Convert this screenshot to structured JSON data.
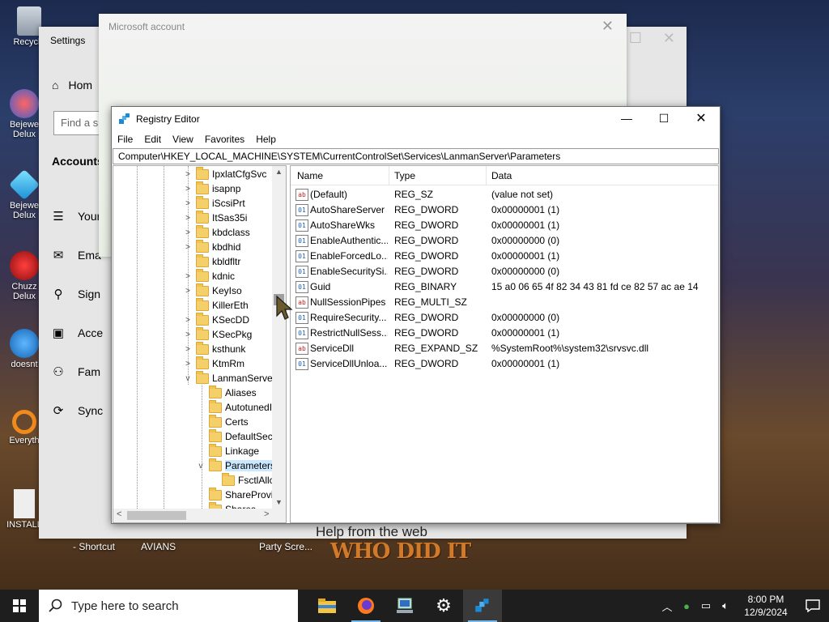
{
  "desktop": {
    "icons": [
      {
        "label": "Recycle"
      },
      {
        "label": "Bejewe Delux"
      },
      {
        "label": "Bejewe Delux"
      },
      {
        "label": "Chuzz Delux"
      },
      {
        "label": "doesnt"
      },
      {
        "label": "Everyth"
      },
      {
        "label": "INSTALL"
      }
    ],
    "bottom_labels": [
      "- Shortcut",
      "AVIANS",
      "Party Scre..."
    ],
    "wallpaper_text": "WHO DID IT"
  },
  "settings": {
    "title": "Settings",
    "home": "Hom",
    "search_placeholder": "Find a s",
    "section": "Accounts",
    "nav": [
      {
        "icon": "person-card-icon",
        "label": "Your"
      },
      {
        "label": "Ema",
        "icon": "mail-icon"
      },
      {
        "label": "Sign",
        "icon": "key-icon"
      },
      {
        "label": "Acce",
        "icon": "briefcase-icon"
      },
      {
        "label": "Fam",
        "icon": "family-icon"
      },
      {
        "label": "Sync",
        "icon": "sync-icon"
      }
    ],
    "help": "Help from the web"
  },
  "ms_account": {
    "title": "Microsoft account"
  },
  "regedit": {
    "title": "Registry Editor",
    "menu": [
      "File",
      "Edit",
      "View",
      "Favorites",
      "Help"
    ],
    "address": "Computer\\HKEY_LOCAL_MACHINE\\SYSTEM\\CurrentControlSet\\Services\\LanmanServer\\Parameters",
    "tree": [
      {
        "label": "IpxlatCfgSvc"
      },
      {
        "label": "isapnp"
      },
      {
        "label": "iScsiPrt"
      },
      {
        "label": "ItSas35i"
      },
      {
        "label": "kbdclass"
      },
      {
        "label": "kbdhid"
      },
      {
        "label": "kbldfltr"
      },
      {
        "label": "kdnic"
      },
      {
        "label": "KeyIso"
      },
      {
        "label": "KillerEth"
      },
      {
        "label": "KSecDD"
      },
      {
        "label": "KSecPkg"
      },
      {
        "label": "ksthunk"
      },
      {
        "label": "KtmRm"
      },
      {
        "label": "LanmanServer"
      },
      {
        "label": "Aliases"
      },
      {
        "label": "AutotunedI"
      },
      {
        "label": "Certs"
      },
      {
        "label": "DefaultSecu"
      },
      {
        "label": "Linkage"
      },
      {
        "label": "Parameters"
      },
      {
        "label": "FsctlAllc"
      },
      {
        "label": "ShareProvid"
      },
      {
        "label": "Shares"
      }
    ],
    "columns": {
      "name": "Name",
      "type": "Type",
      "data": "Data"
    },
    "values": [
      {
        "name": "(Default)",
        "type": "REG_SZ",
        "data": "(value not set)",
        "icon": "string-value-icon"
      },
      {
        "name": "AutoShareServer",
        "type": "REG_DWORD",
        "data": "0x00000001 (1)",
        "icon": "binary-value-icon"
      },
      {
        "name": "AutoShareWks",
        "type": "REG_DWORD",
        "data": "0x00000001 (1)",
        "icon": "binary-value-icon"
      },
      {
        "name": "EnableAuthentic...",
        "type": "REG_DWORD",
        "data": "0x00000000 (0)",
        "icon": "binary-value-icon"
      },
      {
        "name": "EnableForcedLo...",
        "type": "REG_DWORD",
        "data": "0x00000001 (1)",
        "icon": "binary-value-icon"
      },
      {
        "name": "EnableSecuritySi...",
        "type": "REG_DWORD",
        "data": "0x00000000 (0)",
        "icon": "binary-value-icon"
      },
      {
        "name": "Guid",
        "type": "REG_BINARY",
        "data": "15 a0 06 65 4f 82 34 43 81 fd ce 82 57 ac ae 14",
        "icon": "binary-value-icon"
      },
      {
        "name": "NullSessionPipes",
        "type": "REG_MULTI_SZ",
        "data": "",
        "icon": "string-value-icon"
      },
      {
        "name": "RequireSecurity...",
        "type": "REG_DWORD",
        "data": "0x00000000 (0)",
        "icon": "binary-value-icon"
      },
      {
        "name": "RestrictNullSess...",
        "type": "REG_DWORD",
        "data": "0x00000001 (1)",
        "icon": "binary-value-icon"
      },
      {
        "name": "ServiceDll",
        "type": "REG_EXPAND_SZ",
        "data": "%SystemRoot%\\system32\\srvsvc.dll",
        "icon": "string-value-icon"
      },
      {
        "name": "ServiceDllUnloa...",
        "type": "REG_DWORD",
        "data": "0x00000001 (1)",
        "icon": "binary-value-icon"
      }
    ]
  },
  "taskbar": {
    "search_placeholder": "Type here to search",
    "apps": [
      {
        "icon": "file-explorer-icon"
      },
      {
        "icon": "firefox-icon"
      },
      {
        "icon": "network-computer-icon"
      },
      {
        "icon": "settings-gear-icon"
      },
      {
        "icon": "registry-editor-icon"
      }
    ],
    "time": "8:00 PM",
    "date": "12/9/2024"
  },
  "colors": {
    "accent": "#0078d7",
    "selection": "#cce8ff",
    "taskbar": "#1e1e1e"
  }
}
